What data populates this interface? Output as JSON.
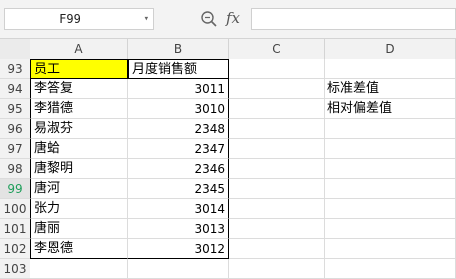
{
  "formula_bar": {
    "name_box": "F99",
    "fx_label": "fx",
    "formula_value": ""
  },
  "columns": [
    "A",
    "B",
    "C",
    "D"
  ],
  "rows": [
    {
      "num": "93",
      "a": "员工",
      "b": "月度销售额",
      "d": ""
    },
    {
      "num": "94",
      "a": "李答复",
      "b": "3011",
      "d": "标准差值"
    },
    {
      "num": "95",
      "a": "李猎德",
      "b": "3010",
      "d": "相对偏差值"
    },
    {
      "num": "96",
      "a": "易淑芬",
      "b": "2348",
      "d": ""
    },
    {
      "num": "97",
      "a": "唐蛤",
      "b": "2347",
      "d": ""
    },
    {
      "num": "98",
      "a": "唐黎明",
      "b": "2346",
      "d": ""
    },
    {
      "num": "99",
      "a": "唐河",
      "b": "2345",
      "d": ""
    },
    {
      "num": "100",
      "a": "张力",
      "b": "3014",
      "d": ""
    },
    {
      "num": "101",
      "a": "唐丽",
      "b": "3013",
      "d": ""
    },
    {
      "num": "102",
      "a": "李恩德",
      "b": "3012",
      "d": ""
    },
    {
      "num": "103",
      "a": "",
      "b": "",
      "d": ""
    }
  ],
  "colors": {
    "header_fill": "#ffff00",
    "active_row_number": "#1e9e5a"
  }
}
